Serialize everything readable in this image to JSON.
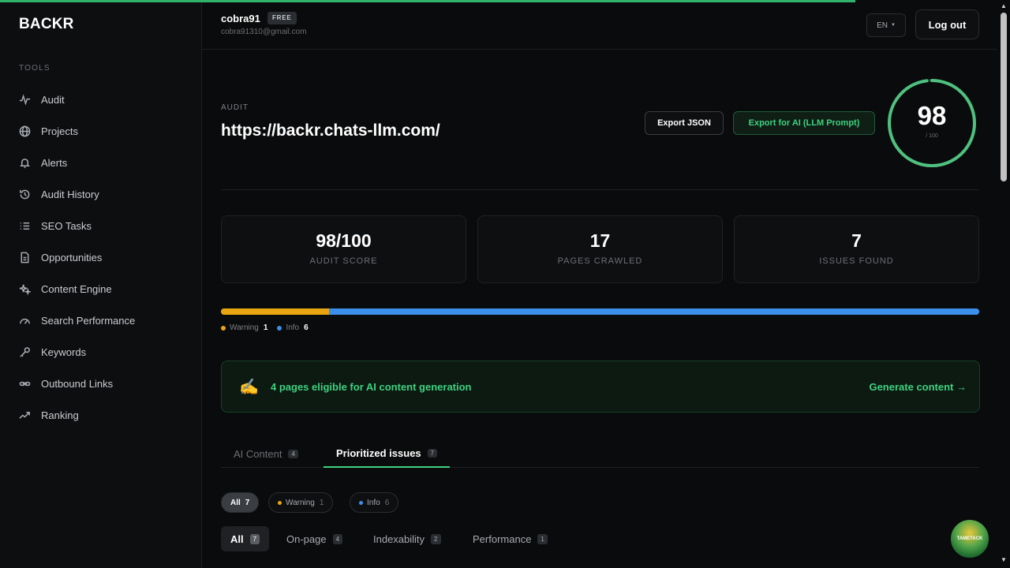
{
  "app": {
    "brand": "BACKR"
  },
  "sidebar": {
    "section_label": "TOOLS",
    "items": [
      {
        "label": "Audit",
        "icon": "activity-icon"
      },
      {
        "label": "Projects",
        "icon": "globe-icon"
      },
      {
        "label": "Alerts",
        "icon": "bell-icon"
      },
      {
        "label": "Audit History",
        "icon": "history-icon"
      },
      {
        "label": "SEO Tasks",
        "icon": "list-icon"
      },
      {
        "label": "Opportunities",
        "icon": "document-icon"
      },
      {
        "label": "Content Engine",
        "icon": "sparkles-icon"
      },
      {
        "label": "Search Performance",
        "icon": "gauge-icon"
      },
      {
        "label": "Keywords",
        "icon": "key-icon"
      },
      {
        "label": "Outbound Links",
        "icon": "link-icon"
      },
      {
        "label": "Ranking",
        "icon": "trend-icon"
      }
    ]
  },
  "header": {
    "user_name": "cobra91",
    "plan_badge": "FREE",
    "user_email": "cobra91310@gmail.com",
    "lang": "EN",
    "logout_label": "Log out"
  },
  "audit": {
    "label": "AUDIT",
    "url": "https://backr.chats-llm.com/",
    "export_json_label": "Export JSON",
    "export_ai_label": "Export for AI (LLM Prompt)",
    "score": "98",
    "score_max": "/ 100",
    "progress_fraction": 0.98
  },
  "stats": [
    {
      "value": "98/100",
      "label": "AUDIT SCORE"
    },
    {
      "value": "17",
      "label": "PAGES CRAWLED"
    },
    {
      "value": "7",
      "label": "ISSUES FOUND"
    }
  ],
  "severity": {
    "warning_label": "Warning",
    "warning_count": "1",
    "info_label": "Info",
    "info_count": "6",
    "warning_share": 0.143,
    "colors": {
      "warning": "#e8a512",
      "info": "#3b8ee9"
    }
  },
  "ai_banner": {
    "emoji": "✍️",
    "text": "4 pages eligible for AI content generation",
    "cta": "Generate content →"
  },
  "tabs": [
    {
      "label": "AI Content",
      "count": "4"
    },
    {
      "label": "Prioritized issues",
      "count": "7"
    }
  ],
  "filters": {
    "all_label": "All",
    "all_count": "7",
    "warning_label": "Warning",
    "warning_count": "1",
    "info_label": "Info",
    "info_count": "6"
  },
  "categories": [
    {
      "label": "All",
      "count": "7"
    },
    {
      "label": "On-page",
      "count": "4"
    },
    {
      "label": "Indexability",
      "count": "2"
    },
    {
      "label": "Performance",
      "count": "1"
    }
  ],
  "floating_badge": {
    "text": "TAMETACK"
  },
  "page_progress_fraction": 0.847,
  "accent_color": "#3fd17f"
}
